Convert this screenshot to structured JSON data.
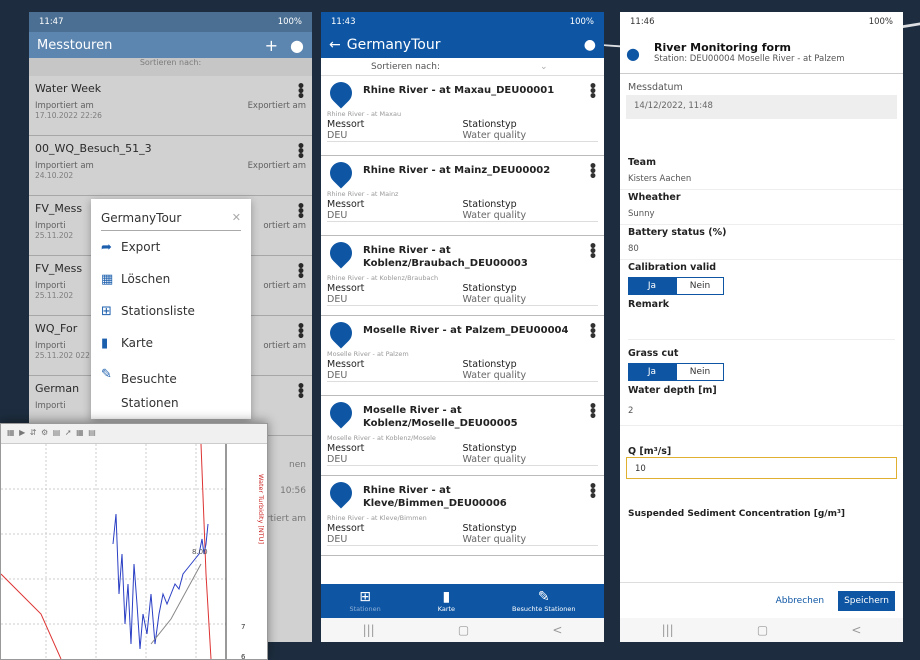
{
  "phone1": {
    "status": {
      "time": "11:47",
      "icons": "·",
      "right": "100%"
    },
    "title": "Messtouren",
    "sort": "Sortieren nach:",
    "tours": [
      {
        "name": "Water Week",
        "imp": "Importiert am",
        "exp": "Exportiert am",
        "date": "17.10.2022 22:26"
      },
      {
        "name": "00_WQ_Besuch_51_3",
        "imp": "Importiert am",
        "exp": "Exportiert am",
        "date": "24.10.202"
      },
      {
        "name": "FV_Mess",
        "imp": "Importi",
        "exp": "ortiert am",
        "date": "25.11.202"
      },
      {
        "name": "FV_Mess",
        "imp": "Importi",
        "exp": "ortiert am",
        "date": "25.11.202"
      },
      {
        "name": "WQ_For",
        "imp": "Importi",
        "exp": "ortiert am",
        "date": "25.11.202 022 15:41"
      },
      {
        "name": "German",
        "imp": "Importi",
        "exp": "",
        "date": ""
      }
    ],
    "menu": {
      "title": "GermanyTour",
      "items": [
        "Export",
        "Löschen",
        "Stationsliste",
        "Karte",
        "Besuchte Stationen"
      ]
    },
    "lower": {
      "fragment": "nen",
      "ex": "rtiert am",
      "date": "10:56"
    }
  },
  "chart": {
    "labels": {
      "top": "8.00",
      "ylabel": "Water Turbidity [NTU]",
      "t7": "7",
      "t6": "6"
    }
  },
  "phone2": {
    "status": {
      "time": "11:43",
      "right": "100%"
    },
    "title": "GermanyTour",
    "sort": "Sortieren nach:",
    "col1": "Messort",
    "col2": "Stationstyp",
    "stations": [
      {
        "name": "Rhine River - at Maxau_DEU00001",
        "sub": "Rhine River - at Maxau",
        "ort": "DEU",
        "typ": "Water quality"
      },
      {
        "name": "Rhine River - at Mainz_DEU00002",
        "sub": "Rhine River - at Mainz",
        "ort": "DEU",
        "typ": "Water quality"
      },
      {
        "name": "Rhine River - at Koblenz/Braubach_DEU00003",
        "sub": "Rhine River - at Koblenz/Braubach",
        "ort": "DEU",
        "typ": "Water quality"
      },
      {
        "name": "Moselle River - at Palzem_DEU00004",
        "sub": "Moselle River - at Palzem",
        "ort": "DEU",
        "typ": "Water quality"
      },
      {
        "name": "Moselle River - at Koblenz/Moselle_DEU00005",
        "sub": "Moselle River - at Koblenz/Mosele",
        "ort": "DEU",
        "typ": "Water quality"
      },
      {
        "name": "Rhine River - at Kleve/Bimmen_DEU00006",
        "sub": "Rhine River - at Kleve/Bimmen",
        "ort": "DEU",
        "typ": "Water quality"
      }
    ],
    "bottom": [
      "Stationen",
      "Karte",
      "Besuchte Stationen"
    ]
  },
  "phone3": {
    "status": {
      "time": "11:46",
      "right": "100%"
    },
    "title": "River Monitoring form",
    "station": "Station: DEU00004 Moselle River - at Palzem",
    "messdatum_label": "Messdatum",
    "messdatum": "14/12/2022, 11:48",
    "team_label": "Team",
    "team": "Kisters Aachen",
    "weather_label": "Wheather",
    "weather": "Sunny",
    "battery_label": "Battery status (%)",
    "battery": "80",
    "calib_label": "Calibration valid",
    "ja": "Ja",
    "nein": "Nein",
    "remark_label": "Remark",
    "grass_label": "Grass cut",
    "depth_label": "Water depth [m]",
    "depth": "2",
    "q_label": "Q [m³/s]",
    "q": "10",
    "ssc_label": "Suspended Sediment Concentration [g/m³]",
    "cancel": "Abbrechen",
    "save": "Speichern"
  },
  "nav": {
    "recents": "|||",
    "home": "▢",
    "back": "<"
  },
  "colors": {
    "blue": "#0e56a4",
    "grey_blue": "#5c86b0"
  }
}
